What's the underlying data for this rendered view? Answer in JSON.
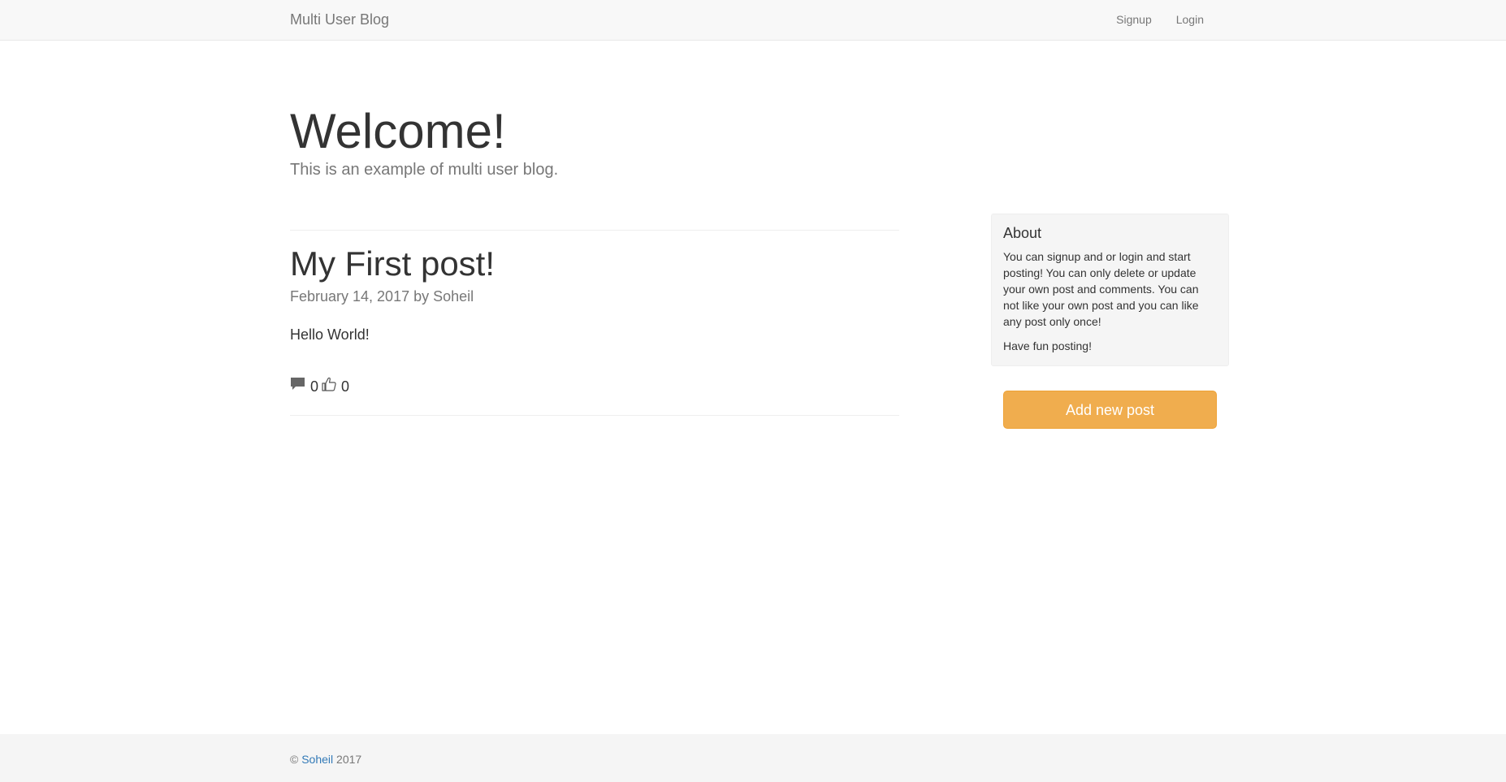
{
  "navbar": {
    "brand": "Multi User Blog",
    "links": [
      {
        "label": "Signup"
      },
      {
        "label": "Login"
      }
    ]
  },
  "hero": {
    "title": "Welcome!",
    "subtitle": "This is an example of multi user blog."
  },
  "posts": [
    {
      "title": "My First post!",
      "date": "February 14, 2017",
      "by": "by",
      "author": "Soheil",
      "body": "Hello World!",
      "comments": "0",
      "likes": "0",
      "comment_icon": "comment-icon",
      "like_icon": "thumbs-up-icon"
    }
  ],
  "sidebar": {
    "about_title": "About",
    "about_text": "You can signup and or login and start posting! You can only delete or update your own post and comments. You can not like your own post and you can like any post only once!",
    "about_text2": "Have fun posting!",
    "add_button": "Add new post"
  },
  "footer": {
    "copyright": "©",
    "author_link": "Soheil",
    "year": "2017"
  },
  "colors": {
    "navbar_bg": "#f8f8f8",
    "button_warning": "#f0ad4e",
    "link": "#337ab7",
    "muted": "#777777"
  }
}
